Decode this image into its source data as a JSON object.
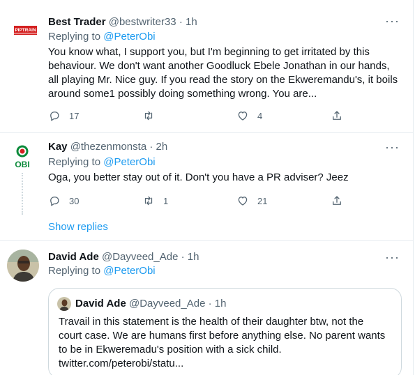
{
  "tweets": [
    {
      "name": "Best Trader",
      "handle": "@bestwriter33",
      "time": "· 1h",
      "avatar_label": "PIPTRAIN",
      "reply_prefix": "Replying to",
      "reply_to": "@PeterObi",
      "text": "You know what, I support you, but I'm beginning to get irritated by this\nbehaviour. We don't want another Goodluck Ebele Jonathan in our hands,\nall playing Mr. Nice guy. If you read the story on the Ekweremandu's, it boils\naround some1 possibly doing something wrong. You are...",
      "replies": "17",
      "retweets": "",
      "likes": "4"
    },
    {
      "name": "Kay",
      "handle": "@thezenmonsta",
      "time": "· 2h",
      "avatar_label": "OBI",
      "reply_prefix": "Replying to",
      "reply_to": "@PeterObi",
      "text": "Oga, you better stay out of it. Don't you have a PR adviser? Jeez",
      "replies": "30",
      "retweets": "1",
      "likes": "21"
    },
    {
      "name": "David Ade",
      "handle": "@Dayveed_Ade",
      "time": "· 1h",
      "reply_prefix": "Replying to",
      "reply_to": "@PeterObi"
    }
  ],
  "show_replies": "Show replies",
  "quote": {
    "name": "David Ade",
    "handle": "@Dayveed_Ade",
    "time": "· 1h",
    "text": "Travail in this statement is the health of their daughter btw, not the\ncourt case. We are humans first before anything else. No parent wants\nto be in Ekweremadu's position with a sick child.\ntwitter.com/peterobi/statu..."
  },
  "more_glyph": "···",
  "colors": {
    "accent": "#1d9bf0",
    "muted": "#536471",
    "text": "#0f1419",
    "border": "#e6ecf0"
  },
  "icons": [
    "reply-icon",
    "retweet-icon",
    "like-icon",
    "share-icon",
    "more-icon"
  ]
}
